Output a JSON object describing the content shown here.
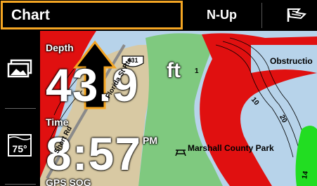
{
  "header": {
    "view_title": "Chart",
    "orientation": "N-Up",
    "chart_flag_icon": "chart-flag-icon"
  },
  "sidebar": {
    "buttons": [
      {
        "name": "image-gallery-icon"
      },
      {
        "name": "temperature-icon",
        "value": "75°"
      }
    ]
  },
  "overlays": {
    "depth": {
      "label": "Depth",
      "value": "43.9",
      "unit": "ft"
    },
    "time": {
      "label": "Time",
      "value": "8:57",
      "ampm": "PM"
    },
    "gps_sog": {
      "label": "GPS SOG"
    }
  },
  "map_labels": {
    "road": "Short Rd",
    "road2": "Florida St Rte",
    "highway_shield": "431",
    "park": "Marshall County Park",
    "obstruction": "Obstructio",
    "contour_10": "10",
    "contour_20": "20",
    "contour_1": "1",
    "contour_14": "14"
  },
  "colors": {
    "accent": "#f5a623",
    "shallow": "#e01010",
    "land": "#7fc97f",
    "water": "#b7d3ea",
    "sand": "#d8c9a3"
  }
}
